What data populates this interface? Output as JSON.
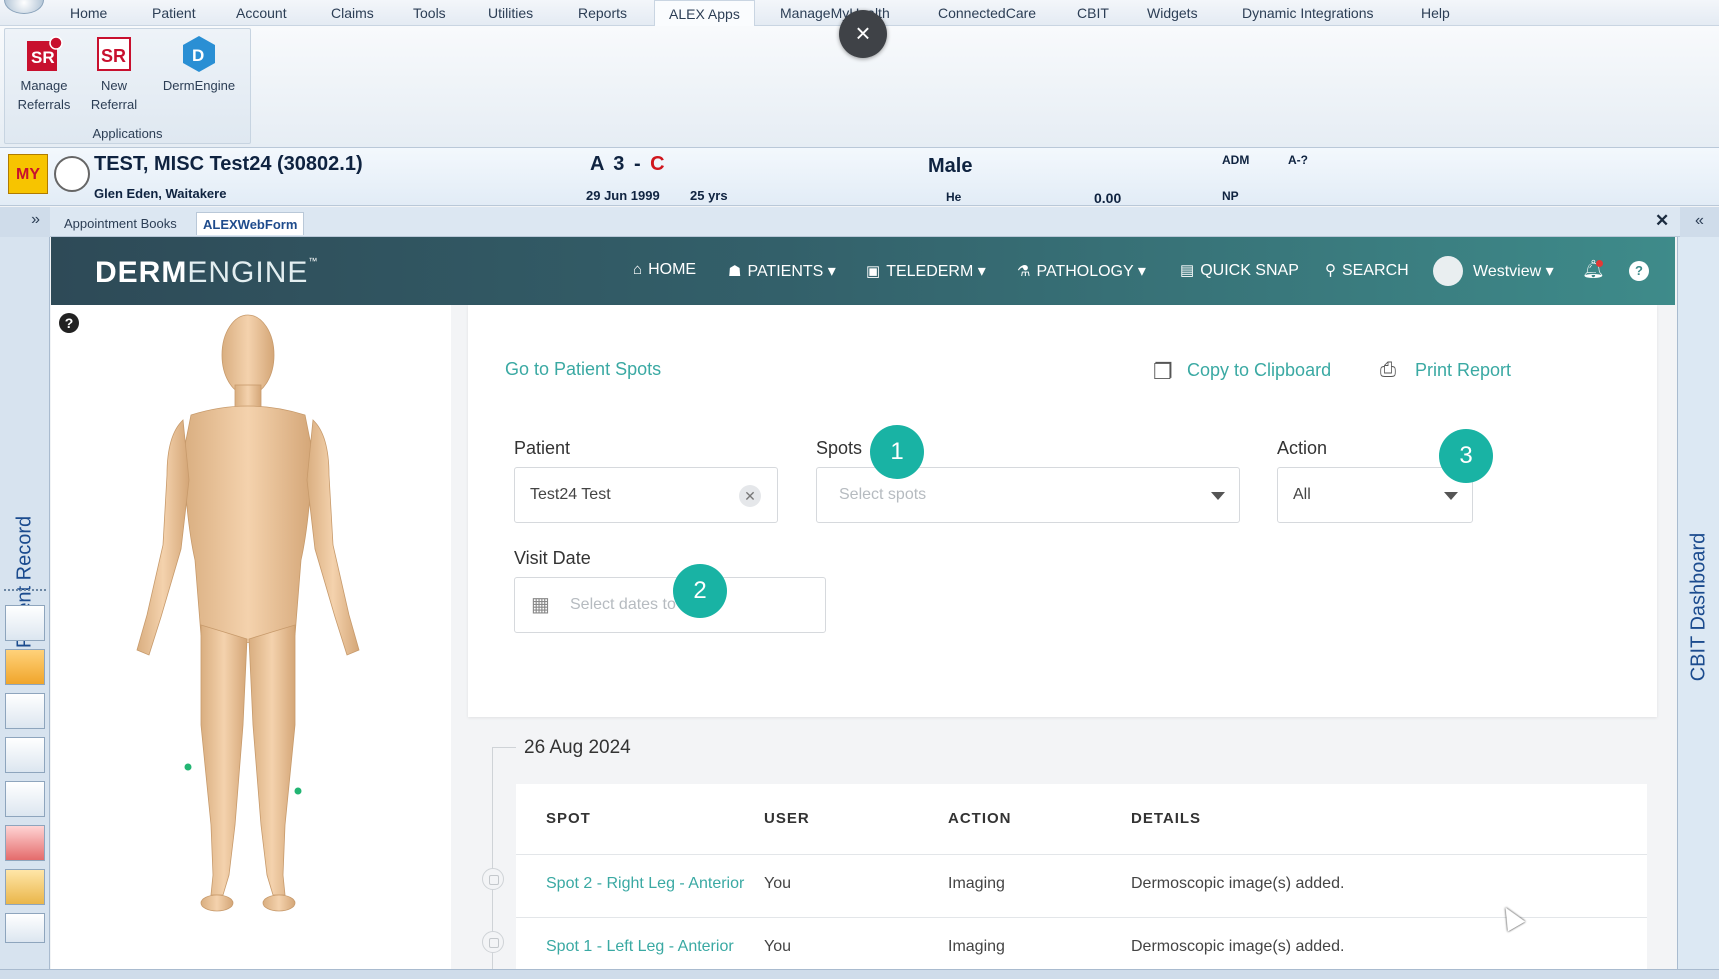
{
  "menu": {
    "items": [
      "Home",
      "Patient",
      "Account",
      "Claims",
      "Tools",
      "Utilities",
      "Reports",
      "ALEX Apps",
      "ManageMyHealth",
      "ConnectedCare",
      "CBIT",
      "Widgets",
      "Dynamic Integrations",
      "Help"
    ],
    "active": "ALEX Apps"
  },
  "overlay": {
    "close_label": "×"
  },
  "ribbon": {
    "buttons": [
      {
        "label_line1": "Manage",
        "label_line2": "Referrals",
        "icon": "manage-referrals-icon"
      },
      {
        "label_line1": "New",
        "label_line2": "Referral",
        "icon": "new-referral-icon"
      },
      {
        "label_line1": "DermEngine",
        "label_line2": "",
        "icon": "dermengine-icon"
      }
    ],
    "group_label": "Applications"
  },
  "patient": {
    "logo_text": "MY",
    "name": "TEST, MISC Test24 (30802.1)",
    "address": "Glen Eden, Waitakere",
    "code_a": "A 3 -",
    "code_c": "C",
    "dob": "29 Jun 1999",
    "age": "25 yrs",
    "sex": "Male",
    "he": "He",
    "balance": "0.00",
    "adm": "ADM",
    "a_flag": "A-?",
    "np": "NP"
  },
  "tabs": {
    "expand": "»",
    "items": [
      "Appointment Books",
      "ALEXWebForm"
    ],
    "close": "✕",
    "collapse": "«"
  },
  "side": {
    "left_label": "Patient Record",
    "right_label": "CBIT Dashboard"
  },
  "dermengine": {
    "logo_bold": "DERM",
    "logo_thin": "ENGINE",
    "logo_tm": "™",
    "nav": {
      "home": "HOME",
      "patients": "PATIENTS",
      "telederm": "TELEDERM",
      "pathology": "PATHOLOGY",
      "quick_snap": "QUICK SNAP",
      "search": "SEARCH",
      "user": "Westview",
      "help": "?"
    },
    "body_help": "?",
    "filters": {
      "go_to_spots": "Go to Patient Spots",
      "copy": "Copy to Clipboard",
      "print": "Print Report",
      "patient_label": "Patient",
      "patient_value": "Test24 Test",
      "spots_label": "Spots",
      "spots_placeholder": "Select spots",
      "action_label": "Action",
      "action_value": "All",
      "visit_label": "Visit Date",
      "visit_placeholder": "Select dates to filter"
    },
    "badges": [
      "1",
      "2",
      "3"
    ],
    "timeline": {
      "date": "26 Aug 2024",
      "columns": [
        "SPOT",
        "USER",
        "ACTION",
        "DETAILS"
      ],
      "rows": [
        {
          "spot": "Spot 2 - Right Leg - Anterior",
          "user": "You",
          "action": "Imaging",
          "details": "Dermoscopic image(s) added."
        },
        {
          "spot": "Spot 1 - Left Leg - Anterior",
          "user": "You",
          "action": "Imaging",
          "details": "Dermoscopic image(s) added."
        }
      ]
    }
  },
  "colors": {
    "accent": "#3aa9a3",
    "badge": "#19b3a4",
    "nav_dark": "#2e4a57",
    "nav_light": "#3e8b8a"
  }
}
